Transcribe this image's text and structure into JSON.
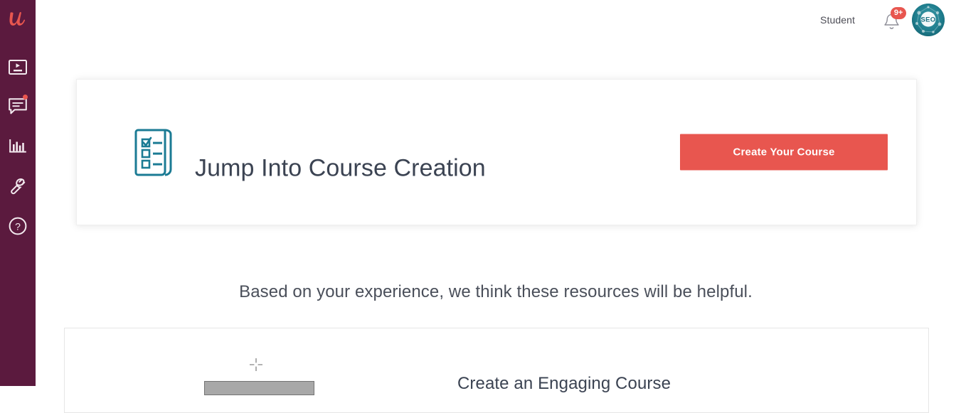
{
  "brand": {
    "logo_icon": "udemy-u-logo",
    "sidebar_color": "#5b1a3e",
    "accent_color": "#e8564f",
    "teal_color": "#1b7b94"
  },
  "sidebar": {
    "items": [
      {
        "icon": "video-course-icon",
        "label": "Courses",
        "has_badge": false
      },
      {
        "icon": "chat-bubble-icon",
        "label": "Messages",
        "has_badge": true
      },
      {
        "icon": "bar-chart-icon",
        "label": "Performance",
        "has_badge": false
      },
      {
        "icon": "wrench-icon",
        "label": "Tools",
        "has_badge": false
      },
      {
        "icon": "question-circle-icon",
        "label": "Help",
        "has_badge": false
      }
    ]
  },
  "header": {
    "role_label": "Student",
    "notifications": {
      "icon": "bell-icon",
      "badge_count": "9+"
    },
    "avatar": {
      "icon": "user-avatar",
      "text": "SEO"
    }
  },
  "hero": {
    "icon": "checklist-document-icon",
    "title": "Jump Into Course Creation",
    "cta_label": "Create Your Course"
  },
  "main": {
    "subheading": "Based on your experience, we think these resources will be helpful."
  },
  "resources": [
    {
      "thumbnail_icon": "plus-crosshair-icon",
      "title": "Create an Engaging Course"
    }
  ]
}
